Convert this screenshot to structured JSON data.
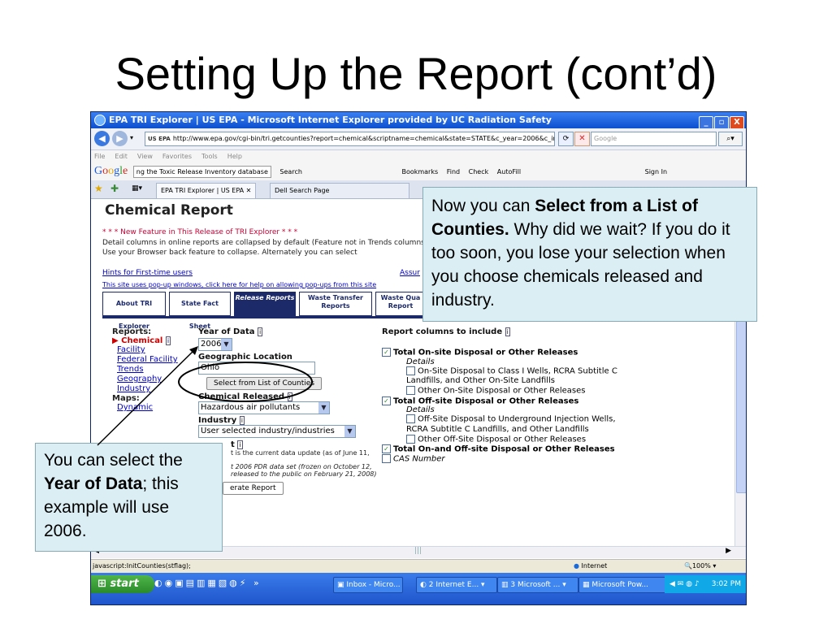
{
  "slide": {
    "title": "Setting Up the Report (cont’d)"
  },
  "window": {
    "title": "EPA TRI Explorer | US EPA - Microsoft Internet Explorer provided by UC Radiation Safety",
    "controls": [
      "_",
      "▫",
      "X"
    ]
  },
  "address_bar": {
    "url": "http://www.epa.gov/cgi-bin/tri.getcounties?report=chemical&scriptname=chemical&state=STATE&c_year=2006&c_industry",
    "search_placeholder": "Google",
    "favicon": "US EPA"
  },
  "menu": [
    "File",
    "Edit",
    "View",
    "Favorites",
    "Tools",
    "Help"
  ],
  "google_toolbar": {
    "search_text": "ng the Toxic Release Inventory database",
    "items": [
      "Search",
      "Bookmarks",
      "Find",
      "Check",
      "AutoFill",
      "Sign In"
    ]
  },
  "browser_tabs": [
    "EPA TRI Explorer | US EPA",
    "Dell Search Page"
  ],
  "page": {
    "heading": "Chemical Report",
    "notice": "* * * New Feature in This Release of TRI Explorer * * *",
    "detail": "Detail columns in online reports are collapsed by default (Feature not in Trends columns. Use your Browser back feature to collapse. Alternately you can select",
    "hints_link": "Hints for First-time users",
    "assur_link": "Assur",
    "popup_link": "This site uses pop-up windows, click here for help on allowing pop-ups from this site",
    "top_tabs": [
      {
        "label": "About TRI Explorer"
      },
      {
        "label": "State Fact Sheet"
      },
      {
        "label": "Release Reports"
      },
      {
        "label": "Waste Transfer Reports"
      },
      {
        "label": "Waste Qua Report"
      }
    ],
    "leftnav": {
      "reports_label": "Reports:",
      "current": "Chemical",
      "links": [
        "Facility",
        "Federal Facility",
        "Trends",
        "Geography",
        "Industry"
      ],
      "maps_label": "Maps:",
      "maps_links": [
        "Dynamic"
      ]
    },
    "form": {
      "year_label": "Year of Data",
      "year_value": "2006",
      "geo_label": "Geographic Location",
      "geo_value": "Ohio",
      "select_counties_button": "Select from List of Counties",
      "chem_label": "Chemical Released",
      "chem_value": "Hazardous air pollutants",
      "industry_label": "Industry",
      "industry_value": "User selected industry/industries",
      "dataset_label": "t",
      "dataset_line1": "t is the current data update (as of June 11,",
      "dataset_line2": "t 2006 PDR data set (frozen on October 12,",
      "dataset_line3": "released to the public on February 21, 2008)",
      "generate_button": "erate Report"
    },
    "columns": {
      "header": "Report columns to include",
      "details_label": "Details",
      "items": [
        {
          "label": "Total On-site Disposal or Other Releases",
          "checked": true
        },
        {
          "label": "On-Site Disposal to Class I Wells, RCRA Subtitle C Landfills, and Other On-Site Landfills",
          "checked": false
        },
        {
          "label": "Other On-Site Disposal or Other Releases",
          "checked": false
        },
        {
          "label": "Total Off-site Disposal or Other Releases",
          "checked": true
        },
        {
          "label": "Off-Site Disposal to Underground Injection Wells, RCRA Subtitle C Landfills, and Other Landfills",
          "checked": false
        },
        {
          "label": "Other Off-Site Disposal or Other Releases",
          "checked": false
        },
        {
          "label": "Total On-and Off-site Disposal or Other Releases",
          "checked": true
        },
        {
          "label": "CAS Number",
          "checked": false
        }
      ]
    }
  },
  "status": {
    "text": "javascript:InitCounties(stflag);",
    "zone": "Internet",
    "zoom": "100%"
  },
  "taskbar": {
    "start": "start",
    "items": [
      "Inbox - Micro...",
      "2 Internet E...",
      "3 Microsoft ...",
      "Microsoft Pow..."
    ],
    "clock": "3:02 PM"
  },
  "callouts": {
    "top_pre": "Now you can ",
    "top_bold": "Select from a List of Counties.",
    "top_post": " Why did we wait? If you do it too soon, you lose your selection when you choose chemicals released and industry.",
    "left_pre": "You can select the ",
    "left_bold": "Year of Data",
    "left_post": "; this example will use 2006."
  },
  "colors": {
    "epa_navy": "#1c2a6a",
    "link": "#0000cc",
    "callout_bg": "#dbeef4",
    "xp_blue": "#1f55cc"
  }
}
